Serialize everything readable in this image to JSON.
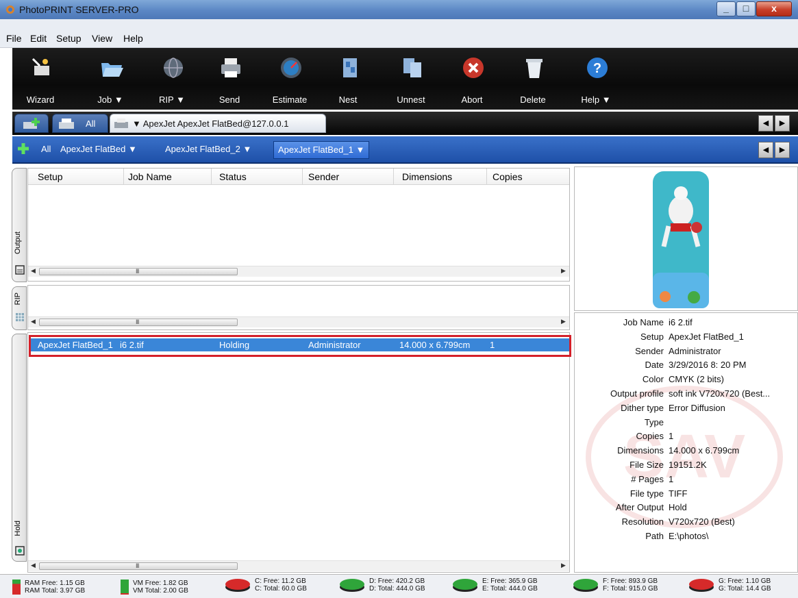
{
  "window": {
    "title": "PhotoPRINT SERVER-PRO",
    "close_glyph": "x",
    "min_glyph": "_",
    "max_glyph": "□"
  },
  "menu": [
    "File",
    "Edit",
    "Setup",
    "View",
    "Help"
  ],
  "toolbar": [
    {
      "label": "Wizard",
      "icon": "wizard-icon"
    },
    {
      "label": "Job ▼",
      "icon": "folder-icon"
    },
    {
      "label": "RIP ▼",
      "icon": "globe-icon"
    },
    {
      "label": "Send",
      "icon": "printer-icon"
    },
    {
      "label": "Estimate",
      "icon": "gauge-icon"
    },
    {
      "label": "Nest",
      "icon": "nest-icon"
    },
    {
      "label": "Unnest",
      "icon": "unnest-icon"
    },
    {
      "label": "Abort",
      "icon": "abort-icon"
    },
    {
      "label": "Delete",
      "icon": "trash-icon"
    },
    {
      "label": "Help ▼",
      "icon": "help-icon"
    }
  ],
  "printer_tabs": {
    "all": "All",
    "active": "▼  ApexJet ApexJet FlatBed@127.0.0.1"
  },
  "queue_tabs": {
    "all": "All",
    "items": [
      "ApexJet FlatBed  ▼",
      "ApexJet FlatBed_2  ▼",
      "ApexJet FlatBed_1  ▼"
    ]
  },
  "nav": {
    "left": "◀",
    "right": "▶"
  },
  "side_tabs": {
    "output": "Output",
    "rip": "RIP",
    "hold": "Hold"
  },
  "columns": [
    "Setup",
    "Job Name",
    "Status",
    "Sender",
    "Dimensions",
    "Copies"
  ],
  "scroll": {
    "left": "◀",
    "right": "▶",
    "grip": "III"
  },
  "hold_job": {
    "setup": "ApexJet FlatBed_1",
    "job_name": "i6 2.tif",
    "status": "Holding",
    "sender": "Administrator",
    "dimensions": "14.000 x 6.799cm",
    "copies": "1"
  },
  "properties": [
    {
      "key": "Job Name",
      "value": "i6 2.tif"
    },
    {
      "key": "Setup",
      "value": "ApexJet FlatBed_1"
    },
    {
      "key": "Sender",
      "value": "Administrator"
    },
    {
      "key": "Date",
      "value": "3/29/2016 8: 20 PM"
    },
    {
      "key": "Color",
      "value": "CMYK (2 bits)"
    },
    {
      "key": "Output profile",
      "value": "soft ink V720x720 (Best..."
    },
    {
      "key": "Dither type",
      "value": "Error Diffusion"
    },
    {
      "key": "Type",
      "value": ""
    },
    {
      "key": "Copies",
      "value": "1"
    },
    {
      "key": "Dimensions",
      "value": "14.000 x 6.799cm"
    },
    {
      "key": "File Size",
      "value": "19151.2K"
    },
    {
      "key": "# Pages",
      "value": "1"
    },
    {
      "key": "File type",
      "value": "TIFF"
    },
    {
      "key": "After Output",
      "value": "Hold"
    },
    {
      "key": "Resolution",
      "value": "V720x720 (Best)"
    },
    {
      "key": "Path",
      "value": "E:\\photos\\"
    }
  ],
  "status": {
    "ram": {
      "free": "RAM Free: 1.15 GB",
      "total": "RAM Total: 3.97 GB",
      "used_fraction": 0.71
    },
    "vm": {
      "free": "VM Free: 1.82 GB",
      "total": "VM Total: 2.00 GB",
      "used_fraction": 0.09
    },
    "disks": [
      {
        "free": "C: Free: 11.2 GB",
        "total": "C: Total: 60.0 GB",
        "color": "#d62a2a"
      },
      {
        "free": "D: Free: 420.2 GB",
        "total": "D: Total: 444.0 GB",
        "color": "#2fa53a"
      },
      {
        "free": "E: Free: 365.9 GB",
        "total": "E: Total: 444.0 GB",
        "color": "#2fa53a"
      },
      {
        "free": "F: Free: 893.9 GB",
        "total": "F: Total: 915.0 GB",
        "color": "#2fa53a"
      },
      {
        "free": "G: Free: 1.10 GB",
        "total": "G: Total: 14.4 GB",
        "color": "#d62a2a"
      }
    ]
  }
}
